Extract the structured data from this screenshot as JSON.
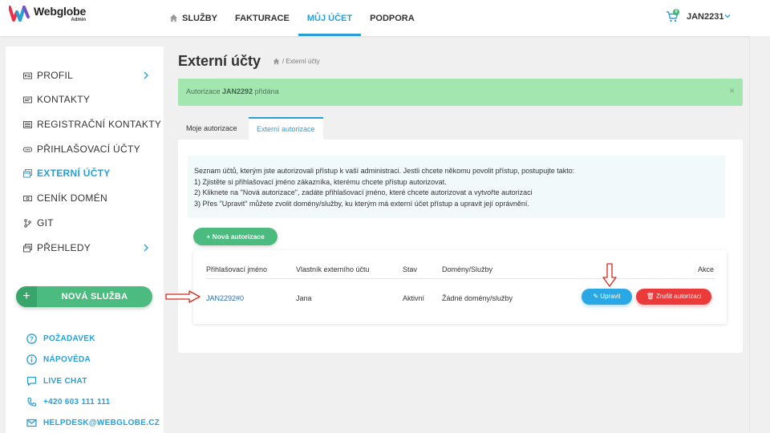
{
  "brand": {
    "name": "Webglobe",
    "sub": "Admin"
  },
  "nav": [
    {
      "label": "SLUŽBY",
      "icon": "home-icon",
      "active": false
    },
    {
      "label": "FAKTURACE",
      "active": false
    },
    {
      "label": "MŮJ ÚČET",
      "active": true
    },
    {
      "label": "PODPORA",
      "active": false
    }
  ],
  "cart": {
    "count": "0"
  },
  "user": {
    "name": "JAN2231"
  },
  "sidebar": {
    "items": [
      {
        "label": "PROFIL",
        "icon": "profile-card-icon",
        "chevron": true
      },
      {
        "label": "KONTAKTY",
        "icon": "contacts-icon"
      },
      {
        "label": "REGISTRAČNÍ KONTAKTY",
        "icon": "registration-contacts-icon"
      },
      {
        "label": "PŘIHLAŠOVACÍ ÚČTY",
        "icon": "login-accounts-icon"
      },
      {
        "label": "EXTERNÍ ÚČTY",
        "icon": "external-accounts-icon",
        "active": true
      },
      {
        "label": "CENÍK DOMÉN",
        "icon": "domain-pricing-icon"
      },
      {
        "label": "GIT",
        "icon": "git-icon"
      },
      {
        "label": "PŘEHLEDY",
        "icon": "reports-icon",
        "chevron": true
      }
    ],
    "new_service": {
      "plus": "+",
      "label": "NOVÁ SLUŽBA"
    },
    "help": [
      {
        "label": "POŽADAVEK",
        "icon": "question-icon"
      },
      {
        "label": "NÁPOVĚDA",
        "icon": "info-icon"
      },
      {
        "label": "LIVE CHAT",
        "icon": "chat-icon"
      },
      {
        "label": "+420 603 111 111",
        "icon": "phone-icon"
      },
      {
        "label": "HELPDESK@WEBGLOBE.CZ",
        "icon": "mail-icon"
      }
    ]
  },
  "page": {
    "title": "Externí účty",
    "breadcrumb": "/ Externí účty"
  },
  "alert": {
    "prefix": "Autorizace",
    "strong": "JAN2292",
    "suffix": "přidána",
    "close": "×"
  },
  "tabs": [
    {
      "label": "Moje autorizace",
      "active": false
    },
    {
      "label": "Externí autorizace",
      "active": true
    }
  ],
  "info": [
    "Seznam účtů, kterým jste autorizovali přístup k vaší administraci. Jestli chcete někomu povolit přístup, postupujte takto:",
    "1) Zjistěte si přihlašovací jméno zákazníka, kterému chcete přístup autorizovat.",
    "2) Kliknete na \"Nová autorizace\", zadáte přihlašovací jméno, které chcete autorizovat a vytvořte autorizaci",
    "3) Přes \"Upravit\" můžete zvolit domény/služby, ku kterým má externí účet přístup a upravit její oprávnění."
  ],
  "add_button": "+ Nová autorizace",
  "table": {
    "headers": [
      "Přihlašovací jméno",
      "Vlastník externího účtu",
      "Stav",
      "Domény/Služby",
      "Akce"
    ],
    "rows": [
      {
        "login": "JAN2292#0",
        "owner": "Jana",
        "status": "Aktivní",
        "domains": "Žádné domény/služby",
        "edit": "Upravit",
        "cancel": "Zrušit autorizaci"
      }
    ]
  },
  "colors": {
    "accent": "#2a9fd6",
    "green": "#4cbb7f",
    "red": "#ea3a3a",
    "alert_bg": "#a3e6b0",
    "annotation": "#d9261c"
  }
}
